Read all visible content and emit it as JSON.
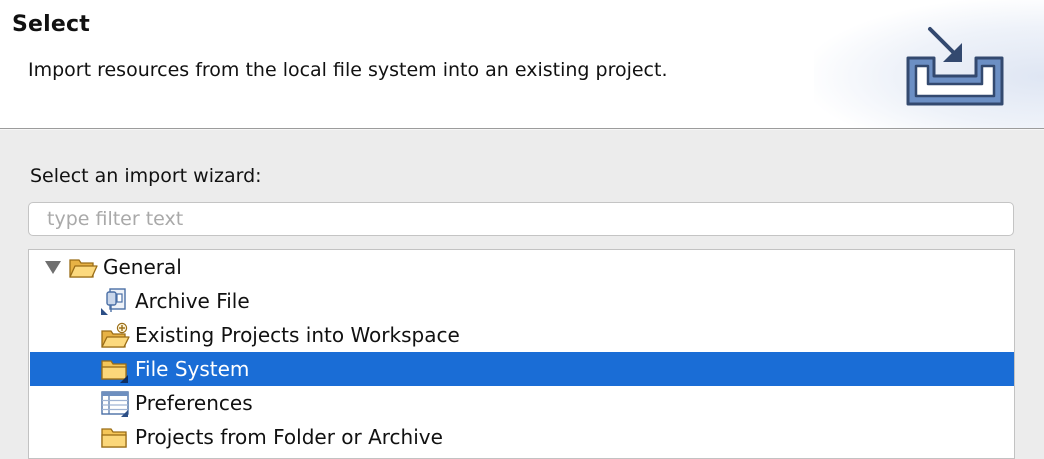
{
  "header": {
    "title": "Select",
    "description": "Import resources from the local file system into an existing project."
  },
  "wizard_label": "Select an import wizard:",
  "filter": {
    "placeholder": "type filter text",
    "value": ""
  },
  "tree": {
    "category": {
      "label": "General",
      "expanded": true,
      "icon": "open-folder-icon"
    },
    "items": [
      {
        "label": "Archive File",
        "icon": "archive-file-icon",
        "selected": false
      },
      {
        "label": "Existing Projects into Workspace",
        "icon": "project-folder-icon",
        "selected": false
      },
      {
        "label": "File System",
        "icon": "folder-icon",
        "selected": true
      },
      {
        "label": "Preferences",
        "icon": "preferences-icon",
        "selected": false
      },
      {
        "label": "Projects from Folder or Archive",
        "icon": "folder-icon",
        "selected": false
      }
    ]
  },
  "colors": {
    "selection": "#1a6dd6",
    "folder": "#f3c25a",
    "icon_blue": "#4a6fa5"
  }
}
